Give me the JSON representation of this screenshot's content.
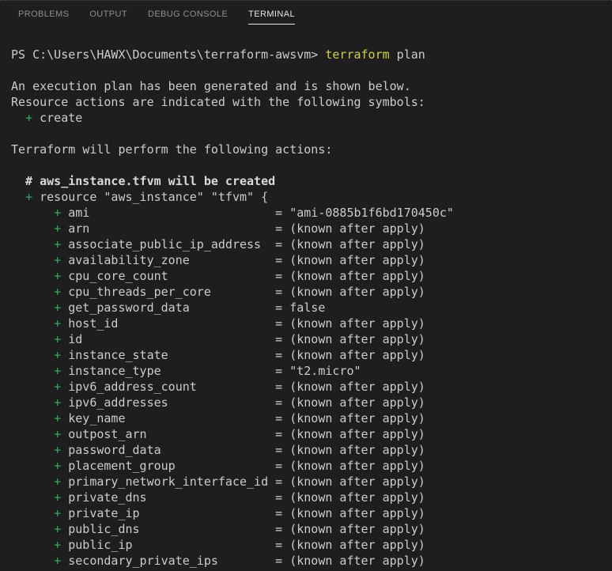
{
  "panel": {
    "tabs": [
      {
        "label": "PROBLEMS",
        "active": false
      },
      {
        "label": "OUTPUT",
        "active": false
      },
      {
        "label": "DEBUG CONSOLE",
        "active": false
      },
      {
        "label": "TERMINAL",
        "active": true
      }
    ]
  },
  "colors": {
    "background": "#1e1e1e",
    "foreground": "#cccccc",
    "command_yellow": "#d0d13f",
    "create_green": "#2fab5f",
    "tab_inactive": "#8f8f8f",
    "tab_active": "#e7e7e7"
  },
  "terminal": {
    "attr_pad": 28,
    "lines": [
      {
        "seg": [
          [
            "PS C:\\Users\\HAWX\\Documents\\terraform-awsvm> ",
            "fg"
          ],
          [
            "terraform",
            "yellow"
          ],
          [
            " plan",
            "fg"
          ]
        ]
      },
      {
        "seg": []
      },
      {
        "seg": [
          [
            "An execution plan has been generated and is shown below.",
            "fg"
          ]
        ]
      },
      {
        "seg": [
          [
            "Resource actions are indicated with the following symbols:",
            "fg"
          ]
        ]
      },
      {
        "seg": [
          [
            "  ",
            "fg"
          ],
          [
            "+",
            "green"
          ],
          [
            " create",
            "fg"
          ]
        ]
      },
      {
        "seg": []
      },
      {
        "seg": [
          [
            "Terraform will perform the following actions:",
            "fg"
          ]
        ]
      },
      {
        "seg": []
      },
      {
        "seg": [
          [
            "  # aws_instance.tfvm will be created",
            "fgbold"
          ]
        ]
      },
      {
        "seg": [
          [
            "  ",
            "fg"
          ],
          [
            "+",
            "green"
          ],
          [
            " resource \"aws_instance\" \"tfvm\" {",
            "fg"
          ]
        ]
      },
      {
        "attr": {
          "name": "ami",
          "value": "\"ami-0885b1f6bd170450c\""
        }
      },
      {
        "attr": {
          "name": "arn",
          "value": "(known after apply)"
        }
      },
      {
        "attr": {
          "name": "associate_public_ip_address",
          "value": "(known after apply)"
        }
      },
      {
        "attr": {
          "name": "availability_zone",
          "value": "(known after apply)"
        }
      },
      {
        "attr": {
          "name": "cpu_core_count",
          "value": "(known after apply)"
        }
      },
      {
        "attr": {
          "name": "cpu_threads_per_core",
          "value": "(known after apply)"
        }
      },
      {
        "attr": {
          "name": "get_password_data",
          "value": "false"
        }
      },
      {
        "attr": {
          "name": "host_id",
          "value": "(known after apply)"
        }
      },
      {
        "attr": {
          "name": "id",
          "value": "(known after apply)"
        }
      },
      {
        "attr": {
          "name": "instance_state",
          "value": "(known after apply)"
        }
      },
      {
        "attr": {
          "name": "instance_type",
          "value": "\"t2.micro\""
        }
      },
      {
        "attr": {
          "name": "ipv6_address_count",
          "value": "(known after apply)"
        }
      },
      {
        "attr": {
          "name": "ipv6_addresses",
          "value": "(known after apply)"
        }
      },
      {
        "attr": {
          "name": "key_name",
          "value": "(known after apply)"
        }
      },
      {
        "attr": {
          "name": "outpost_arn",
          "value": "(known after apply)"
        }
      },
      {
        "attr": {
          "name": "password_data",
          "value": "(known after apply)"
        }
      },
      {
        "attr": {
          "name": "placement_group",
          "value": "(known after apply)"
        }
      },
      {
        "attr": {
          "name": "primary_network_interface_id",
          "value": "(known after apply)"
        }
      },
      {
        "attr": {
          "name": "private_dns",
          "value": "(known after apply)"
        }
      },
      {
        "attr": {
          "name": "private_ip",
          "value": "(known after apply)"
        }
      },
      {
        "attr": {
          "name": "public_dns",
          "value": "(known after apply)"
        }
      },
      {
        "attr": {
          "name": "public_ip",
          "value": "(known after apply)"
        }
      },
      {
        "attr": {
          "name": "secondary_private_ips",
          "value": "(known after apply)"
        }
      }
    ]
  }
}
